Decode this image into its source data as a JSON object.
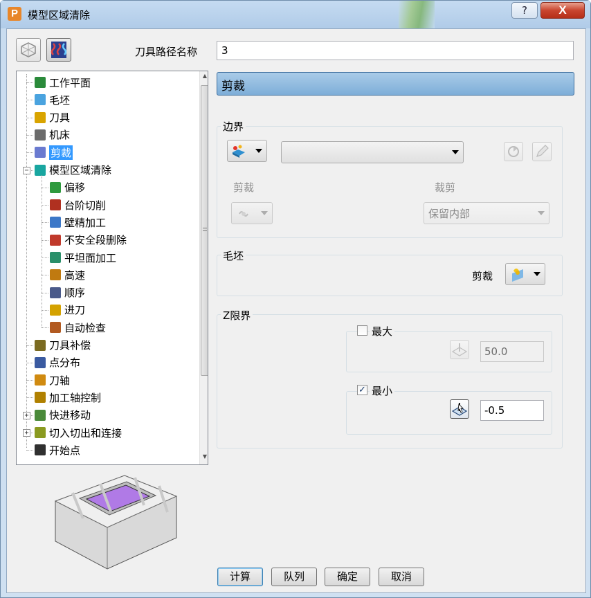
{
  "window": {
    "title": "模型区域清除",
    "help_label": "?",
    "close_label": "X"
  },
  "toolpath_name": {
    "label": "刀具路径名称",
    "value": "3"
  },
  "tree": {
    "items": [
      {
        "label": "工作平面",
        "icon": "workplane-icon",
        "color": "#2a8a3a"
      },
      {
        "label": "毛坯",
        "icon": "stock-block-icon",
        "color": "#4aa3df"
      },
      {
        "label": "刀具",
        "icon": "tool-icon",
        "color": "#d9a400"
      },
      {
        "label": "机床",
        "icon": "machine-icon",
        "color": "#6b6b6b"
      },
      {
        "label": "剪裁",
        "icon": "trim-icon",
        "color": "#6a7ad0"
      },
      {
        "label": "模型区域清除",
        "icon": "area-clear-icon",
        "color": "#19a6a0"
      },
      {
        "label": "偏移",
        "icon": "offset-icon",
        "color": "#2f9a3e"
      },
      {
        "label": "台阶切削",
        "icon": "step-cut-icon",
        "color": "#b03020"
      },
      {
        "label": "壁精加工",
        "icon": "wall-finish-icon",
        "color": "#3c78c8"
      },
      {
        "label": "不安全段删除",
        "icon": "unsafe-remove-icon",
        "color": "#c0392b"
      },
      {
        "label": "平坦面加工",
        "icon": "flat-machining-icon",
        "color": "#2a8f6a"
      },
      {
        "label": "高速",
        "icon": "high-speed-icon",
        "color": "#c07a10"
      },
      {
        "label": "顺序",
        "icon": "order-icon",
        "color": "#4a5a8a"
      },
      {
        "label": "进刀",
        "icon": "plunge-icon",
        "color": "#d4a200"
      },
      {
        "label": "自动检查",
        "icon": "auto-check-icon",
        "color": "#b25a20"
      },
      {
        "label": "刀具补偿",
        "icon": "tool-compensation-icon",
        "color": "#7a6a20"
      },
      {
        "label": "点分布",
        "icon": "point-distribution-icon",
        "color": "#3a5aa0"
      },
      {
        "label": "刀轴",
        "icon": "tool-axis-icon",
        "color": "#d08a10"
      },
      {
        "label": "加工轴控制",
        "icon": "axis-control-icon",
        "color": "#b08000"
      },
      {
        "label": "快进移动",
        "icon": "rapid-move-icon",
        "color": "#4a8a3a"
      },
      {
        "label": "切入切出和连接",
        "icon": "lead-link-icon",
        "color": "#8a9a20"
      },
      {
        "label": "开始点",
        "icon": "start-point-icon",
        "color": "#303030"
      }
    ]
  },
  "section": {
    "title": "剪裁"
  },
  "boundary": {
    "group_label": "边界",
    "boundary_value": "",
    "trim_label": "剪裁",
    "cut_label": "裁剪",
    "keep_value": "保留内部"
  },
  "stock": {
    "group_label": "毛坯",
    "trim_label": "剪裁"
  },
  "zlimits": {
    "group_label": "Z限界",
    "max_label": "最大",
    "max_checked": false,
    "max_value": "50.0",
    "min_label": "最小",
    "min_checked": true,
    "min_value": "-0.5"
  },
  "buttons": {
    "calculate": "计算",
    "queue": "队列",
    "ok": "确定",
    "cancel": "取消"
  },
  "colors": {
    "header_blue": "#8ab6de",
    "selection": "#3399ff",
    "preview_purple": "#b07ae6"
  }
}
